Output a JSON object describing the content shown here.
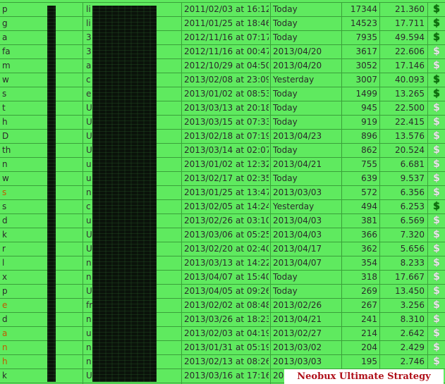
{
  "rows": [
    {
      "username": "p",
      "referrer": "li",
      "since": "2011/02/03 at 16:12",
      "last_click": "Today",
      "clicks": "17344",
      "average": "21.360",
      "icon": "dollar-green",
      "user_color": "dark"
    },
    {
      "username": "g",
      "referrer": "li",
      "since": "2011/01/25 at 18:46",
      "last_click": "Today",
      "clicks": "14523",
      "average": "17.711",
      "icon": "dollar-green",
      "user_color": "dark"
    },
    {
      "username": "a",
      "referrer": "3",
      "since": "2012/11/16 at 07:17",
      "last_click": "Today",
      "clicks": "7935",
      "average": "49.594",
      "icon": "dollar-green",
      "user_color": "dark"
    },
    {
      "username": "fa",
      "referrer": "3",
      "since": "2012/11/16 at 00:47",
      "last_click": "2013/04/20",
      "clicks": "3617",
      "average": "22.606",
      "icon": "dollar-gray",
      "user_color": "dark"
    },
    {
      "username": "m",
      "referrer": "a",
      "since": "2012/10/29 at 04:50",
      "last_click": "2013/04/20",
      "clicks": "3052",
      "average": "17.146",
      "icon": "dollar-gray",
      "user_color": "dark"
    },
    {
      "username": "w",
      "referrer": "c",
      "since": "2013/02/08 at 23:09",
      "last_click": "Yesterday",
      "clicks": "3007",
      "average": "40.093",
      "icon": "dollar-green",
      "user_color": "dark"
    },
    {
      "username": "s",
      "referrer": "e",
      "since": "2013/01/02 at 08:53",
      "last_click": "Today",
      "clicks": "1499",
      "average": "13.265",
      "icon": "dollar-green",
      "user_color": "dark"
    },
    {
      "username": "t",
      "referrer": "U",
      "since": "2013/03/13 at 20:18",
      "last_click": "Today",
      "clicks": "945",
      "average": "22.500",
      "icon": "dollar-gray",
      "user_color": "dark"
    },
    {
      "username": "h",
      "referrer": "U",
      "since": "2013/03/15 at 07:33",
      "last_click": "Today",
      "clicks": "919",
      "average": "22.415",
      "icon": "dollar-gray",
      "user_color": "dark"
    },
    {
      "username": "D",
      "referrer": "U",
      "since": "2013/02/18 at 07:19",
      "last_click": "2013/04/23",
      "clicks": "896",
      "average": "13.576",
      "icon": "dollar-gray",
      "user_color": "dark"
    },
    {
      "username": "th",
      "referrer": "U",
      "since": "2013/03/14 at 02:07",
      "last_click": "Today",
      "clicks": "862",
      "average": "20.524",
      "icon": "dollar-gray",
      "user_color": "dark"
    },
    {
      "username": "n",
      "referrer": "u",
      "since": "2013/01/02 at 12:32",
      "last_click": "2013/04/21",
      "clicks": "755",
      "average": "6.681",
      "icon": "dollar-gray",
      "user_color": "dark"
    },
    {
      "username": "w",
      "referrer": "u",
      "since": "2013/02/17 at 02:35",
      "last_click": "Today",
      "clicks": "639",
      "average": "9.537",
      "icon": "dollar-gray",
      "user_color": "dark"
    },
    {
      "username": "s",
      "referrer": "n",
      "since": "2013/01/25 at 13:47",
      "last_click": "2013/03/03",
      "clicks": "572",
      "average": "6.356",
      "icon": "dollar-gray",
      "user_color": "orange"
    },
    {
      "username": "s",
      "referrer": "c",
      "since": "2013/02/05 at 14:24",
      "last_click": "Yesterday",
      "clicks": "494",
      "average": "6.253",
      "icon": "dollar-green",
      "user_color": "dark"
    },
    {
      "username": "d",
      "referrer": "u",
      "since": "2013/02/26 at 03:10",
      "last_click": "2013/04/03",
      "clicks": "381",
      "average": "6.569",
      "icon": "dollar-gray",
      "user_color": "dark"
    },
    {
      "username": "k",
      "referrer": "U",
      "since": "2013/03/06 at 05:25",
      "last_click": "2013/04/03",
      "clicks": "366",
      "average": "7.320",
      "icon": "dollar-gray",
      "user_color": "dark"
    },
    {
      "username": "r",
      "referrer": "U",
      "since": "2013/02/20 at 02:40",
      "last_click": "2013/04/17",
      "clicks": "362",
      "average": "5.656",
      "icon": "dollar-gray",
      "user_color": "dark"
    },
    {
      "username": "l",
      "referrer": "n",
      "since": "2013/03/13 at 14:22",
      "last_click": "2013/04/07",
      "clicks": "354",
      "average": "8.233",
      "icon": "dollar-gray",
      "user_color": "dark"
    },
    {
      "username": "x",
      "referrer": "n",
      "since": "2013/04/07 at 15:40",
      "last_click": "Today",
      "clicks": "318",
      "average": "17.667",
      "icon": "dollar-gray",
      "user_color": "dark"
    },
    {
      "username": "p",
      "referrer": "U",
      "since": "2013/04/05 at 09:26",
      "last_click": "Today",
      "clicks": "269",
      "average": "13.450",
      "icon": "dollar-gray",
      "user_color": "dark"
    },
    {
      "username": "e",
      "referrer": "fr",
      "since": "2013/02/02 at 08:48",
      "last_click": "2013/02/26",
      "clicks": "267",
      "average": "3.256",
      "icon": "dollar-gray",
      "user_color": "orange"
    },
    {
      "username": "d",
      "referrer": "n",
      "since": "2013/03/26 at 18:23",
      "last_click": "2013/04/21",
      "clicks": "241",
      "average": "8.310",
      "icon": "dollar-gray",
      "user_color": "dark"
    },
    {
      "username": "a",
      "referrer": "u",
      "since": "2013/02/03 at 04:19",
      "last_click": "2013/02/27",
      "clicks": "214",
      "average": "2.642",
      "icon": "dollar-gray",
      "user_color": "orange"
    },
    {
      "username": "n",
      "referrer": "n",
      "since": "2013/01/31 at 05:19",
      "last_click": "2013/03/02",
      "clicks": "204",
      "average": "2.429",
      "icon": "dollar-gray",
      "user_color": "orange"
    },
    {
      "username": "h",
      "referrer": "n",
      "since": "2013/02/13 at 08:26",
      "last_click": "2013/03/03",
      "clicks": "195",
      "average": "2.746",
      "icon": "dollar-gray",
      "user_color": "orange"
    },
    {
      "username": "k",
      "referrer": "U",
      "since": "2013/03/16 at 17:16",
      "last_click": "20",
      "clicks": "",
      "average": "",
      "icon": "none",
      "user_color": "dark"
    }
  ],
  "watermark": "Neobux Ultimate Strategy",
  "icon_glyph": "$",
  "colors": {
    "background": "#5fea5f",
    "grid": "#3aa03a",
    "icon_green": "#0b6e0b",
    "icon_gray": "#e8e8e8",
    "watermark_text": "#b0101a"
  }
}
